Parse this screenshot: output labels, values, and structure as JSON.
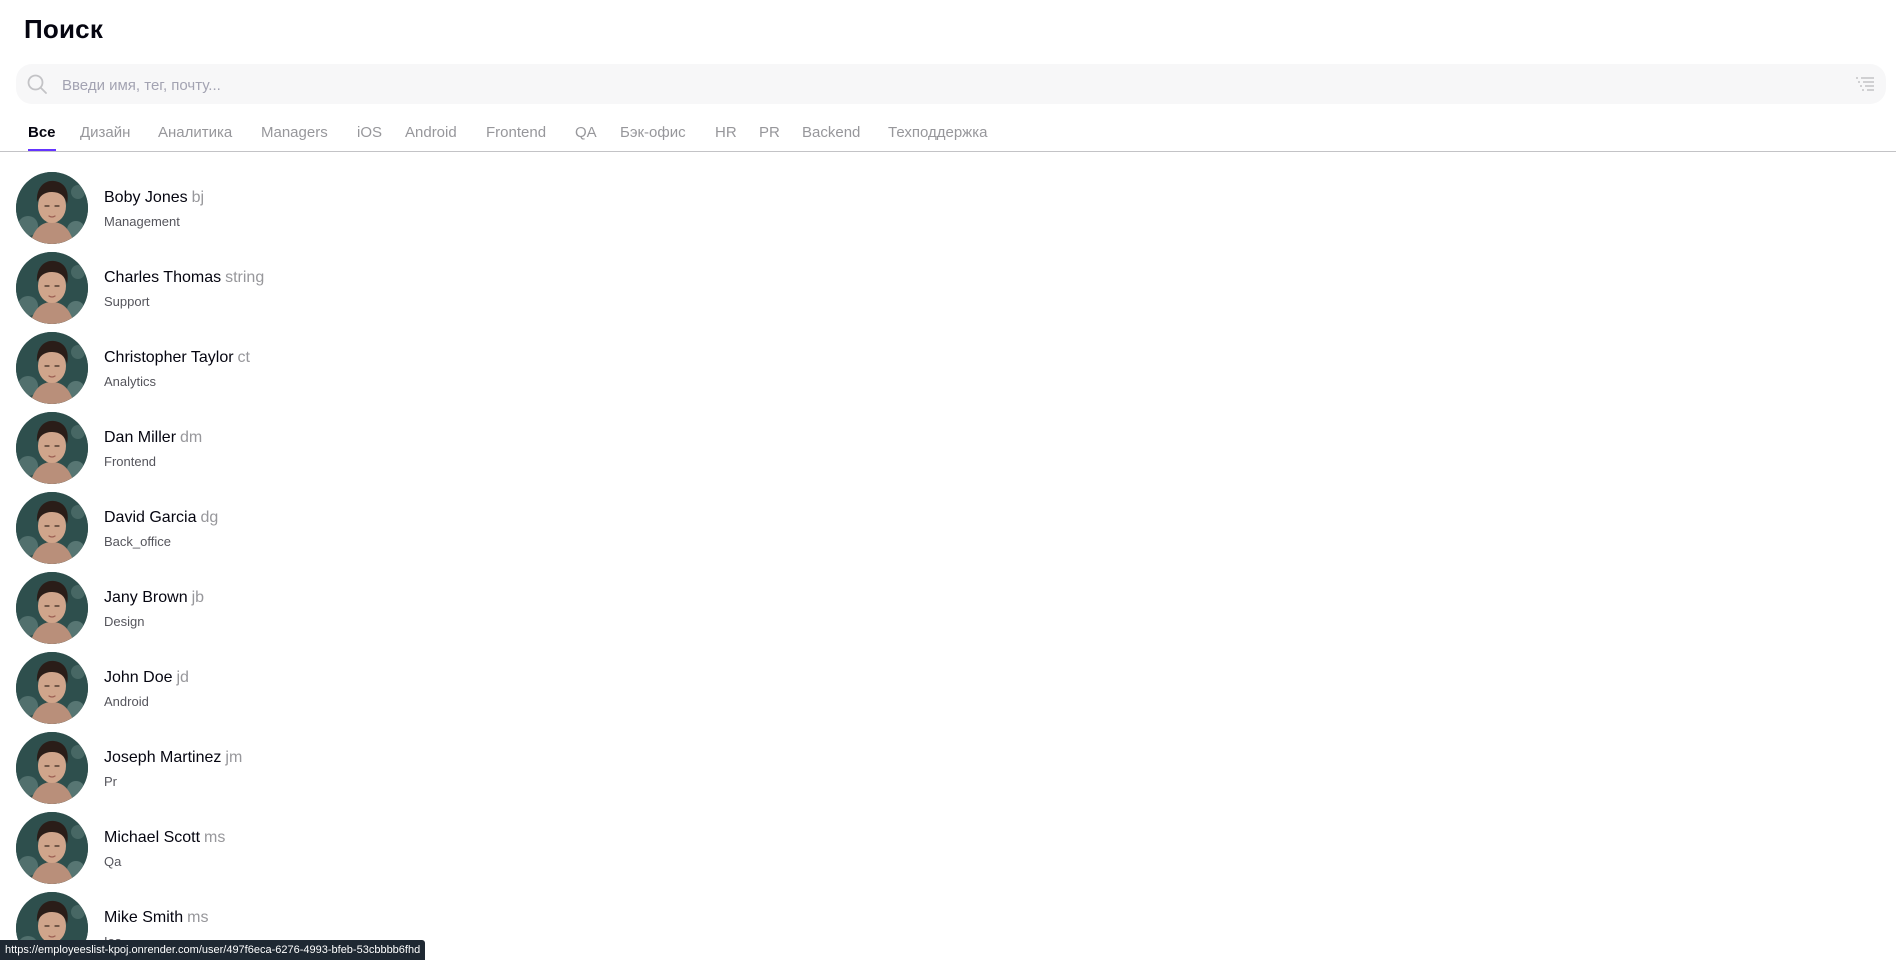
{
  "page": {
    "title": "Поиск"
  },
  "search": {
    "placeholder": "Введи имя, тег, почту...",
    "value": ""
  },
  "tabs": [
    {
      "label": "Все",
      "active": true
    },
    {
      "label": "Дизайн",
      "active": false
    },
    {
      "label": "Аналитика",
      "active": false
    },
    {
      "label": "Managers",
      "active": false
    },
    {
      "label": "iOS",
      "active": false
    },
    {
      "label": "Android",
      "active": false
    },
    {
      "label": "Frontend",
      "active": false
    },
    {
      "label": "QA",
      "active": false
    },
    {
      "label": "Бэк-офис",
      "active": false
    },
    {
      "label": "HR",
      "active": false
    },
    {
      "label": "PR",
      "active": false
    },
    {
      "label": "Backend",
      "active": false
    },
    {
      "label": "Техподдержка",
      "active": false
    }
  ],
  "users": [
    {
      "name": "Boby Jones",
      "tag": "bj",
      "department": "Management"
    },
    {
      "name": "Charles Thomas",
      "tag": "string",
      "department": "Support"
    },
    {
      "name": "Christopher Taylor",
      "tag": "ct",
      "department": "Analytics"
    },
    {
      "name": "Dan Miller",
      "tag": "dm",
      "department": "Frontend"
    },
    {
      "name": "David Garcia",
      "tag": "dg",
      "department": "Back_office"
    },
    {
      "name": "Jany Brown",
      "tag": "jb",
      "department": "Design"
    },
    {
      "name": "John Doe",
      "tag": "jd",
      "department": "Android"
    },
    {
      "name": "Joseph Martinez",
      "tag": "jm",
      "department": "Pr"
    },
    {
      "name": "Michael Scott",
      "tag": "ms",
      "department": "Qa"
    },
    {
      "name": "Mike Smith",
      "tag": "ms",
      "department": "Ios"
    }
  ],
  "status_bar": {
    "url": "https://employeeslist-kpoj.onrender.com/user/497f6eca-6276-4993-bfeb-53cbbbb6fhd"
  },
  "colors": {
    "accent": "#6534ff",
    "muted_text": "#97979b",
    "search_bg": "#f7f7f8"
  },
  "icons": {
    "search": "search-icon",
    "sort": "sort-list-icon"
  }
}
